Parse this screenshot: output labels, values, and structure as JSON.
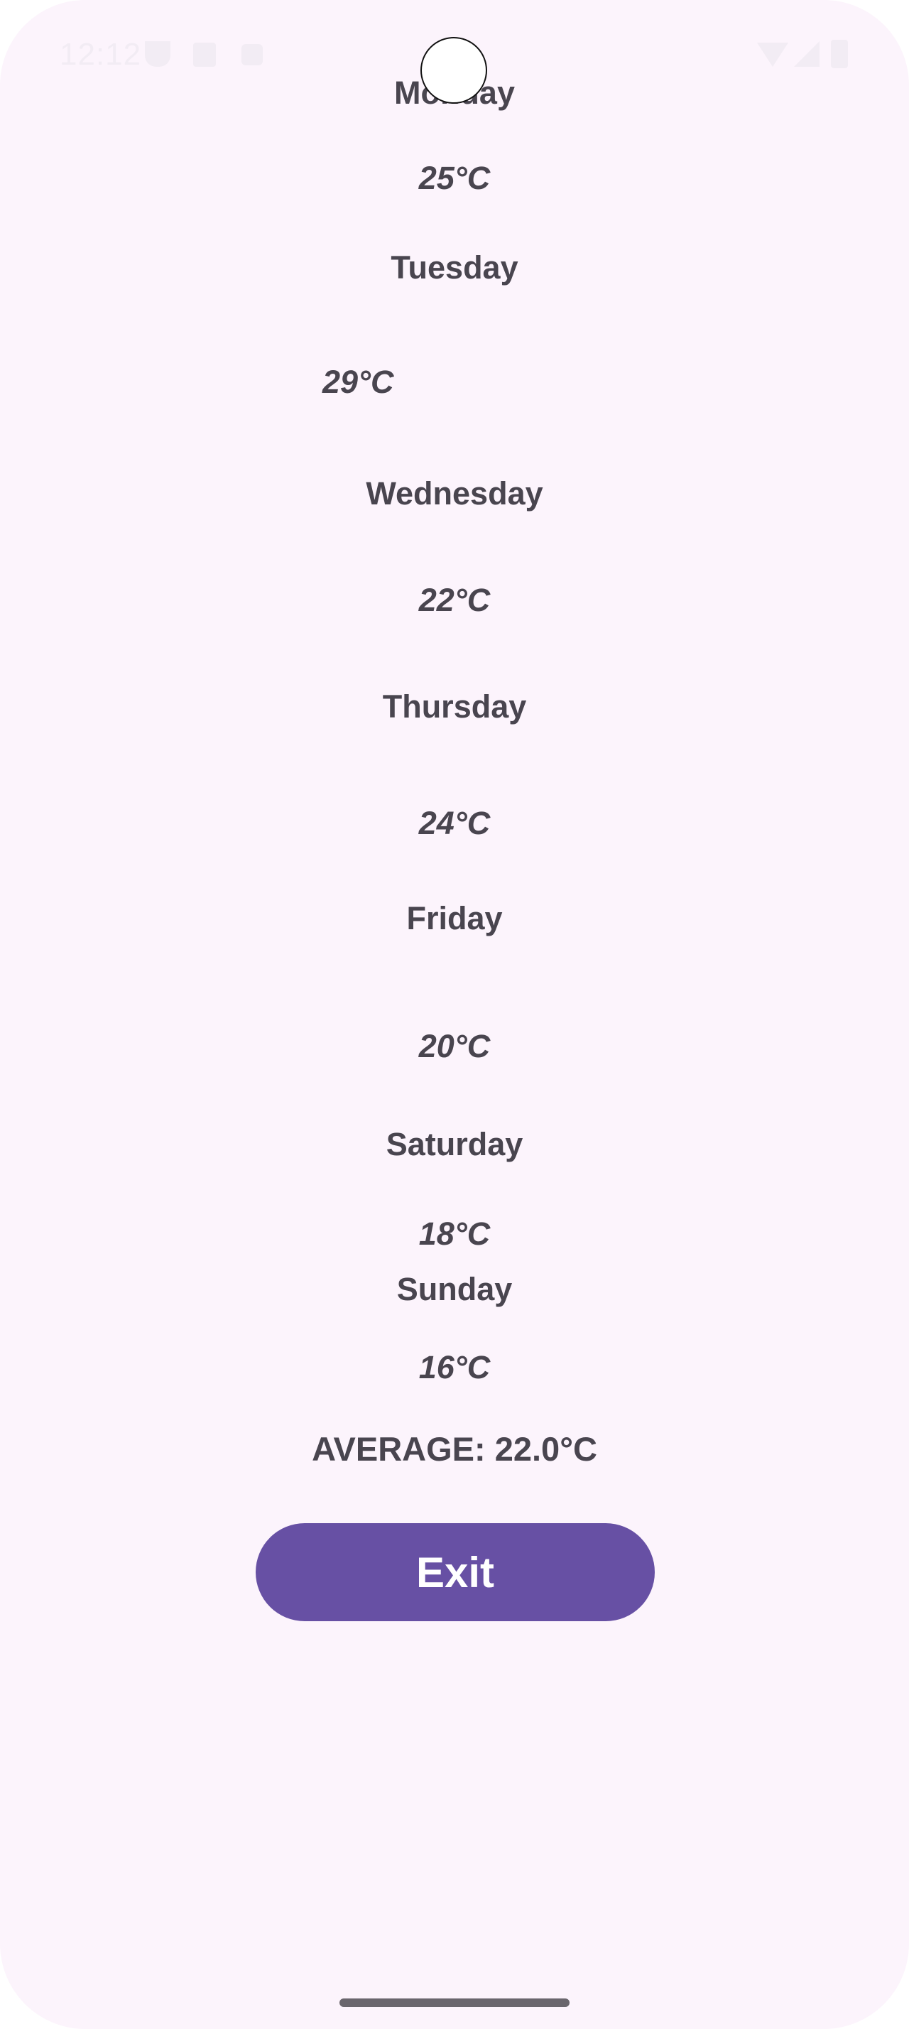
{
  "status_bar": {
    "time": "12:12",
    "icons": [
      "shield-icon",
      "sd-card-icon",
      "square-icon",
      "wifi-icon",
      "cell-signal-icon",
      "battery-icon"
    ]
  },
  "colors": {
    "background": "#FCF4FC",
    "text": "#49454F",
    "button": "#6750A4",
    "button_text": "#FFFFFF"
  },
  "forecast": [
    {
      "day": "Monday",
      "temp": "25°C"
    },
    {
      "day": "Tuesday",
      "temp": "29°C"
    },
    {
      "day": "Wednesday",
      "temp": "22°C"
    },
    {
      "day": "Thursday",
      "temp": "24°C"
    },
    {
      "day": "Friday",
      "temp": "20°C"
    },
    {
      "day": "Saturday",
      "temp": "18°C"
    },
    {
      "day": "Sunday",
      "temp": "16°C"
    }
  ],
  "average": "AVERAGE: 22.0°C",
  "exit_button_label": "Exit"
}
